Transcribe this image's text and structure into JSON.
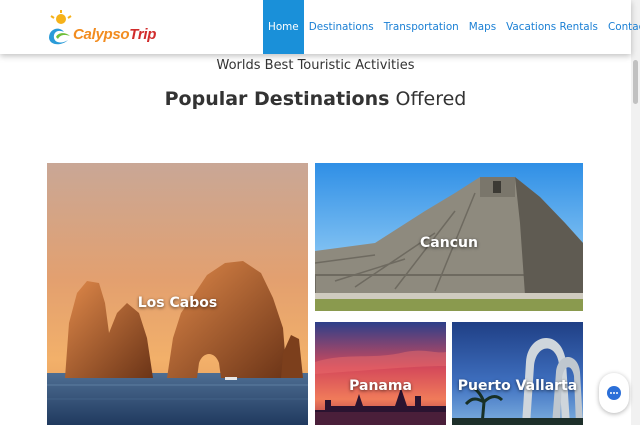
{
  "header": {
    "logo": {
      "part1": "Calypso",
      "part2": "Trip"
    },
    "nav": [
      {
        "label": "Home",
        "active": true
      },
      {
        "label": "Destinations",
        "active": false
      },
      {
        "label": "Transportation",
        "active": false
      },
      {
        "label": "Maps",
        "active": false
      },
      {
        "label": "Vacations Rentals",
        "active": false
      },
      {
        "label": "Contact",
        "active": false
      }
    ]
  },
  "intro": {
    "subheading": "Worlds Best Touristic Activities",
    "heading_bold": "Popular Destinations",
    "heading_rest": "Offered"
  },
  "destinations": [
    {
      "name": "Los Cabos"
    },
    {
      "name": "Cancun"
    },
    {
      "name": "Panama"
    },
    {
      "name": "Puerto Vallarta"
    }
  ],
  "chat": {
    "icon": "chat-bubble-icon"
  },
  "colors": {
    "accent": "#1a90d9",
    "nav_text": "#1a7fd4",
    "logo_orange": "#f28c1f",
    "logo_red": "#d12c2c"
  }
}
